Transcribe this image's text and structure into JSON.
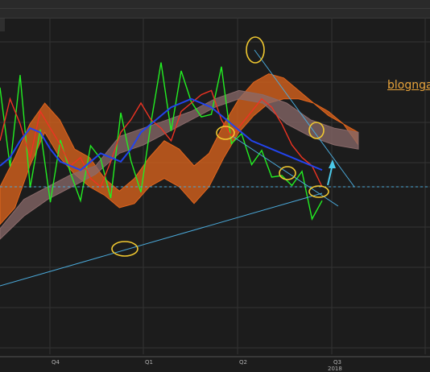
{
  "watermark": "blognga",
  "chart_data": {
    "type": "line",
    "x_ticks": [
      "Q4",
      "Q1",
      "Q2",
      "Q3"
    ],
    "year_label": "2018",
    "series": [
      {
        "color": "#22ee22",
        "values": [
          0.72,
          0.45,
          0.78,
          0.35,
          0.52,
          0.28,
          0.47,
          0.42,
          0.18,
          0.55,
          0.38,
          0.3,
          0.6,
          0.48,
          0.22,
          0.66,
          0.84,
          0.62,
          0.8,
          0.76,
          0.58,
          0.7,
          0.82,
          0.56,
          0.5,
          0.46,
          0.42,
          0.4,
          0.3,
          0.36,
          0.32,
          0.2,
          0.18
        ]
      },
      {
        "color": "#ee3322",
        "values": [
          0.52,
          0.72,
          0.6,
          0.44,
          0.66,
          0.58,
          0.5,
          0.4,
          0.44,
          0.34,
          0.3,
          0.42,
          0.56,
          0.62,
          0.7,
          0.62,
          0.58,
          0.52,
          0.66,
          0.7,
          0.74,
          0.76,
          0.62,
          0.54,
          0.6,
          0.66,
          0.72,
          0.68,
          0.6,
          0.5,
          0.44,
          0.4,
          0.3
        ]
      },
      {
        "color": "#2244ee",
        "values": [
          0.4,
          0.44,
          0.52,
          0.58,
          0.56,
          0.48,
          0.42,
          0.4,
          0.38,
          0.42,
          0.46,
          0.44,
          0.42,
          0.48,
          0.56,
          0.6,
          0.64,
          0.68,
          0.7,
          0.72,
          0.7,
          0.68,
          0.64,
          0.6,
          0.56,
          0.52,
          0.5,
          0.48,
          0.46,
          0.44,
          0.42,
          0.4,
          0.38
        ]
      }
    ],
    "cloud_orange": [
      [
        0.3,
        0.12
      ],
      [
        0.44,
        0.2
      ],
      [
        0.6,
        0.4
      ],
      [
        0.7,
        0.56
      ],
      [
        0.62,
        0.44
      ],
      [
        0.48,
        0.36
      ],
      [
        0.44,
        0.3
      ],
      [
        0.34,
        0.26
      ],
      [
        0.28,
        0.2
      ],
      [
        0.34,
        0.22
      ],
      [
        0.44,
        0.3
      ],
      [
        0.52,
        0.34
      ],
      [
        0.48,
        0.3
      ],
      [
        0.4,
        0.22
      ],
      [
        0.46,
        0.3
      ],
      [
        0.6,
        0.44
      ],
      [
        0.72,
        0.56
      ],
      [
        0.8,
        0.64
      ],
      [
        0.84,
        0.7
      ],
      [
        0.82,
        0.72
      ],
      [
        0.76,
        0.72
      ],
      [
        0.7,
        0.7
      ],
      [
        0.64,
        0.66
      ],
      [
        0.6,
        0.6
      ],
      [
        0.56,
        0.5
      ]
    ],
    "cloud_pink": [
      [
        0.1,
        0.05
      ],
      [
        0.24,
        0.16
      ],
      [
        0.3,
        0.24
      ],
      [
        0.36,
        0.3
      ],
      [
        0.4,
        0.36
      ],
      [
        0.54,
        0.46
      ],
      [
        0.58,
        0.5
      ],
      [
        0.62,
        0.56
      ],
      [
        0.66,
        0.62
      ],
      [
        0.72,
        0.68
      ],
      [
        0.76,
        0.72
      ],
      [
        0.74,
        0.7
      ],
      [
        0.7,
        0.6
      ],
      [
        0.62,
        0.54
      ],
      [
        0.58,
        0.5
      ],
      [
        0.56,
        0.48
      ]
    ],
    "colors": {
      "kumo_orange": "#e2651c",
      "kumo_pink": "#8a6a6a",
      "trendline": "#4aa8d8",
      "circle": "#f0c830",
      "arrow": "#4ac8e8",
      "dashed": "#4aa8d8"
    }
  }
}
